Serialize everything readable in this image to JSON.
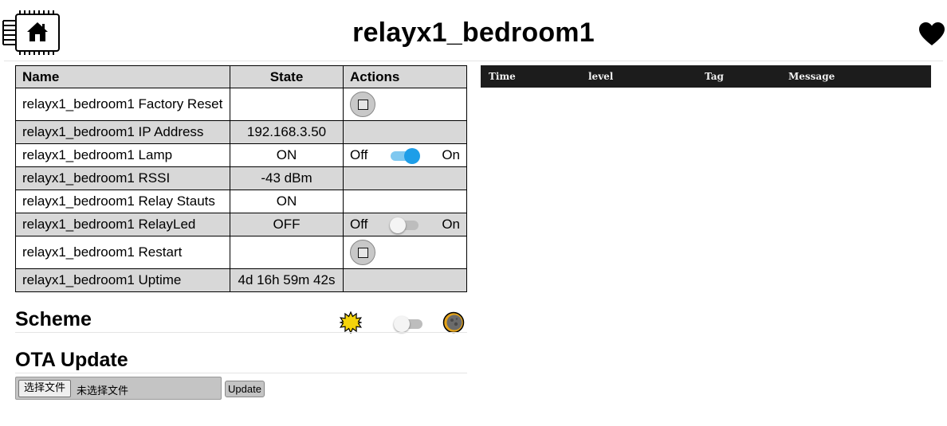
{
  "page": {
    "title": "relayx1_bedroom1"
  },
  "icons": {
    "logo": "chip-home-icon",
    "favorite": "heart-icon"
  },
  "table": {
    "columns": [
      "Name",
      "State",
      "Actions"
    ],
    "rows": [
      {
        "name": "relayx1_bedroom1 Factory Reset",
        "state": "",
        "action": "button"
      },
      {
        "name": "relayx1_bedroom1 IP Address",
        "state": "192.168.3.50",
        "action": "none"
      },
      {
        "name": "relayx1_bedroom1 Lamp",
        "state": "ON",
        "action": "switch",
        "off_label": "Off",
        "on_label": "On",
        "switch_on": true
      },
      {
        "name": "relayx1_bedroom1 RSSI",
        "state": "-43 dBm",
        "action": "none"
      },
      {
        "name": "relayx1_bedroom1 Relay Stauts",
        "state": "ON",
        "action": "none"
      },
      {
        "name": "relayx1_bedroom1 RelayLed",
        "state": "OFF",
        "action": "switch",
        "off_label": "Off",
        "on_label": "On",
        "switch_on": false
      },
      {
        "name": "relayx1_bedroom1 Restart",
        "state": "",
        "action": "button"
      },
      {
        "name": "relayx1_bedroom1 Uptime",
        "state": "4d 16h 59m 42s",
        "action": "none"
      }
    ]
  },
  "scheme": {
    "title": "Scheme",
    "dark_mode": false,
    "light_icon": "sun-icon",
    "dark_icon": "moon-icon"
  },
  "ota": {
    "title": "OTA Update",
    "choose_file_label": "选择文件",
    "no_file_text": "未选择文件",
    "update_label": "Update"
  },
  "log": {
    "headers": {
      "time": "Time",
      "level": "level",
      "tag": "Tag",
      "message": "Message"
    }
  },
  "colors": {
    "row_alt": "#d8d8d8",
    "toggle_on": "#1e9ee8",
    "log_bg": "#1c1c1c"
  }
}
